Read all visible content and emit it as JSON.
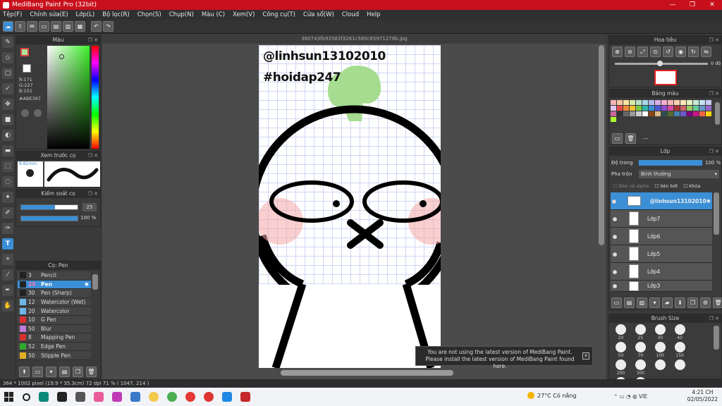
{
  "window": {
    "title": "MediBang Paint Pro (32bit)",
    "buttons": [
      "—",
      "❐",
      "✕"
    ]
  },
  "menu": [
    "Tệp(F)",
    "Chỉnh sửa(E)",
    "Lớp(L)",
    "Bộ lọc(R)",
    "Chọn(S)",
    "Chụp(N)",
    "Màu (C)",
    "Xem(V)",
    "Công cụ(T)",
    "Cửa sổ(W)",
    "Cloud",
    "Help"
  ],
  "document": {
    "tab_name": "380743fb93583f3261c580c65971278b.jpg",
    "text_line1": "@linhsun13102010",
    "text_line2": "#hoidap247"
  },
  "color_panel": {
    "title": "Màu",
    "r": "R:171",
    "g": "G:227",
    "b": "B:151",
    "hex": "#ABE397",
    "fg": "#ABE397"
  },
  "brush_preview": {
    "title": "Xem trước cọ",
    "size": "8.82mm"
  },
  "brush_control": {
    "title": "Kiểm soát cọ",
    "size_value": "25",
    "opacity_value": "100 %",
    "size_fraction": 0.6,
    "opacity_fraction": 1.0
  },
  "brush_list": {
    "title": "Cọ: Pen",
    "items": [
      {
        "size": "3",
        "name": "Pencil",
        "color": "#222222"
      },
      {
        "size": "25",
        "name": "Pen",
        "color": "#222222",
        "active": true
      },
      {
        "size": "30",
        "name": "Pen (Sharp)",
        "color": "#222222"
      },
      {
        "size": "12",
        "name": "Watercolor (Wet)",
        "color": "#6fb6e8"
      },
      {
        "size": "20",
        "name": "Watercolor",
        "color": "#6fb6e8"
      },
      {
        "size": "10",
        "name": "G Pen",
        "color": "#d83030"
      },
      {
        "size": "50",
        "name": "Blur",
        "color": "#c07ad8"
      },
      {
        "size": "8",
        "name": "Mapping Pen",
        "color": "#d83030"
      },
      {
        "size": "52",
        "name": "Edge Pen",
        "color": "#2eaa2e"
      },
      {
        "size": "50",
        "name": "Stipple Pen",
        "color": "#e0b020"
      }
    ]
  },
  "navigator": {
    "title": "Hoa tiêu",
    "angle": "0 độ"
  },
  "palette": {
    "title": "Bảng màu",
    "footer": "---"
  },
  "layers": {
    "title": "Lớp",
    "opacity_label": "Độ trong",
    "opacity_value": "100 %",
    "blend_label": "Pha trộn",
    "blend_value": "Bình thường",
    "checks": [
      "Bảo vệ alpha",
      "Xén bớt",
      "Khóa"
    ],
    "items": [
      {
        "name": "@linhsun13102010",
        "active": true
      },
      {
        "name": "Lớp7"
      },
      {
        "name": "Lớp6"
      },
      {
        "name": "Lớp5"
      },
      {
        "name": "Lớp4"
      },
      {
        "name": "Lớp3"
      }
    ]
  },
  "brush_size": {
    "title": "Brush Size",
    "sizes": [
      "20",
      "25",
      "30",
      "40",
      "50",
      "70",
      "100",
      "150",
      "200",
      "300"
    ]
  },
  "notification": {
    "line1": "You are not using the latest version of MediBang Paint.",
    "line2": "Please install the latest version of MediBang Paint found here."
  },
  "status": {
    "text": "364 * 1002 pixel   (19.9 * 35.3cm)   72 dpi   71 %   ( 1047, 214 )"
  },
  "taskbar": {
    "weather": "27°C  Có nắng",
    "lang": "VIE",
    "time": "4:21 CH",
    "date": "02/05/2022"
  }
}
